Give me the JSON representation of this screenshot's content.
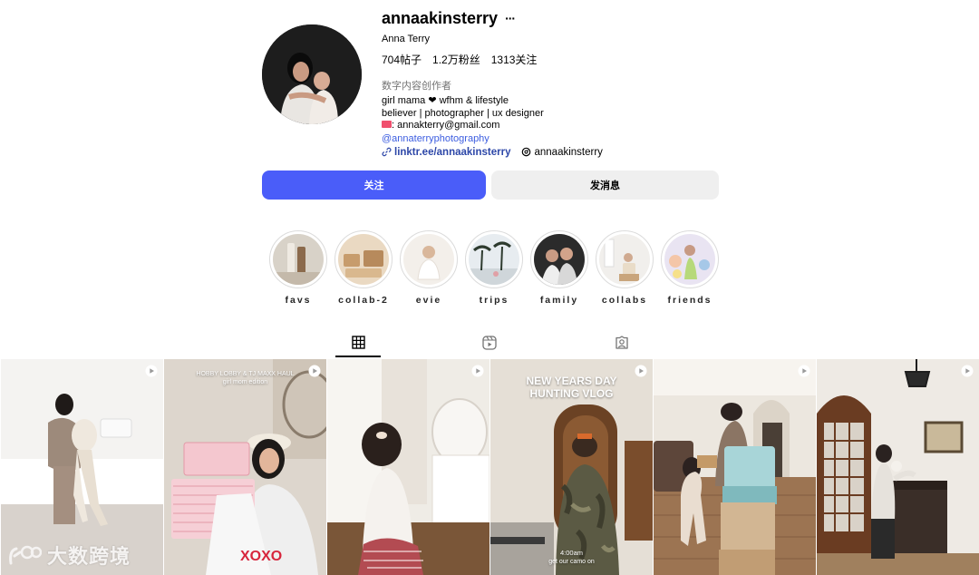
{
  "profile": {
    "username": "annaakinsterry",
    "more": "···",
    "full_name": "Anna Terry",
    "stats": {
      "posts": "704帖子",
      "followers": "1.2万粉丝",
      "following": "1313关注"
    },
    "category": "数字内容创作者",
    "bio": [
      "girl mama ❤ wfhm & lifestyle",
      "believer | photographer | ux designer"
    ],
    "email_line": ": annakterry@gmail.com",
    "handle_link": "@annaterryphotography",
    "external_link": "linktr.ee/annaakinsterry",
    "threads_handle": "annaakinsterry"
  },
  "actions": {
    "follow": "关注",
    "message": "发消息"
  },
  "highlights": [
    {
      "label": "favs"
    },
    {
      "label": "collab-2"
    },
    {
      "label": "evie"
    },
    {
      "label": "trips"
    },
    {
      "label": "family"
    },
    {
      "label": "collabs"
    },
    {
      "label": "friends"
    }
  ],
  "tabs": [
    {
      "name": "posts-grid-icon",
      "active": true
    },
    {
      "name": "reels-icon",
      "active": false
    },
    {
      "name": "tagged-icon",
      "active": false
    }
  ],
  "posts": [
    {
      "caption_lines": []
    },
    {
      "caption_lines": [
        "HOBBY LOBBY & TJ MAXX HAUL",
        "girl mom edition"
      ]
    },
    {
      "caption_lines": []
    },
    {
      "caption_lines": [
        "NEW YEARS DAY",
        "HUNTING VLOG"
      ],
      "bottom_lines": [
        "4:00am",
        "get our camo on"
      ]
    },
    {
      "caption_lines": []
    },
    {
      "caption_lines": []
    }
  ],
  "watermark": "大数跨境",
  "colors": {
    "accent": "#4a5df9",
    "link": "#2d47a8",
    "secondary_text": "#737373",
    "button_gray": "#efefef"
  }
}
